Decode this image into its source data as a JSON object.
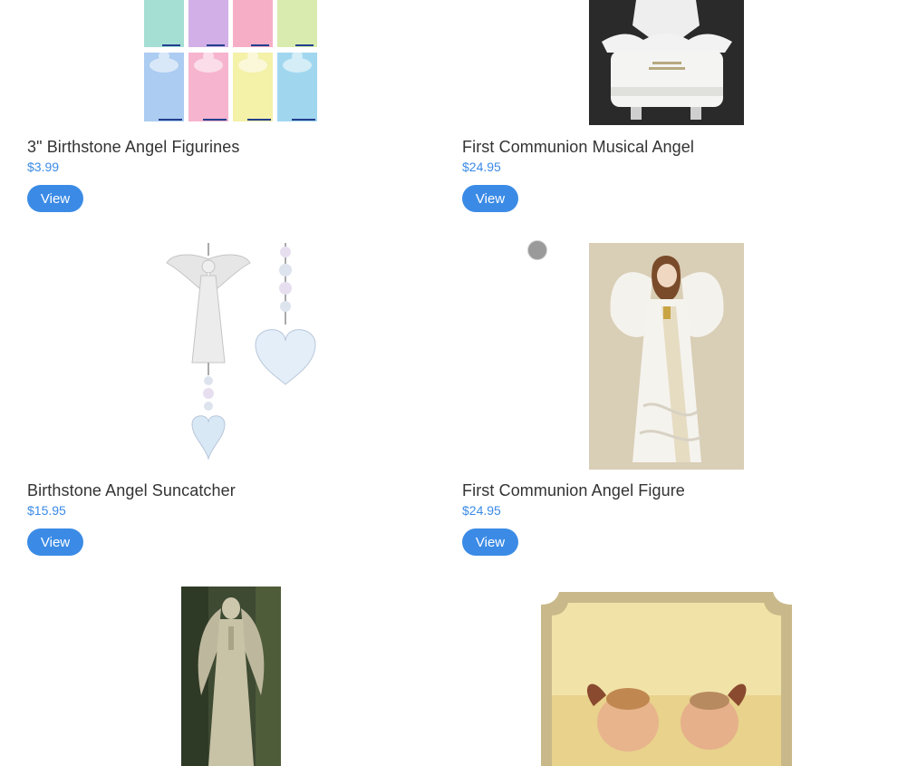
{
  "products": [
    {
      "title": "3\" Birthstone Angel Figurines",
      "price": "$3.99",
      "view_label": "View",
      "image": "birthstone-angel-figurines-image"
    },
    {
      "title": "First Communion Musical Angel",
      "price": "$24.95",
      "view_label": "View",
      "image": "communion-musical-angel-image"
    },
    {
      "title": "Birthstone Angel Suncatcher",
      "price": "$15.95",
      "view_label": "View",
      "image": "angel-suncatcher-image"
    },
    {
      "title": "First Communion Angel Figure",
      "price": "$24.95",
      "view_label": "View",
      "image": "communion-angel-figure-image"
    },
    {
      "image": "garden-angel-statue-image"
    },
    {
      "image": "cherubs-plaque-image"
    }
  ],
  "colors": {
    "accent": "#3b8be6",
    "title_text": "#333333",
    "background": "#ffffff"
  }
}
